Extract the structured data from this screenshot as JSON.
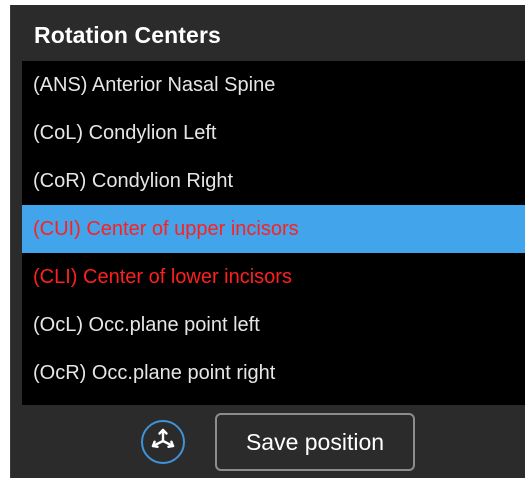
{
  "panel": {
    "title": "Rotation Centers"
  },
  "rotation_centers": {
    "items": [
      {
        "label": "(ANS) Anterior Nasal Spine",
        "selected": false,
        "color": "#e6e6e6"
      },
      {
        "label": "(CoL) Condylion Left",
        "selected": false,
        "color": "#e6e6e6"
      },
      {
        "label": "(CoR) Condylion Right",
        "selected": false,
        "color": "#e6e6e6"
      },
      {
        "label": "(CUI) Center of upper incisors",
        "selected": true,
        "color": "#ff1f1f"
      },
      {
        "label": "(CLI) Center of lower incisors",
        "selected": false,
        "color": "#ff1f1f"
      },
      {
        "label": "(OcL) Occ.plane point left",
        "selected": false,
        "color": "#e6e6e6"
      },
      {
        "label": "(OcR) Occ.plane point right",
        "selected": false,
        "color": "#e6e6e6"
      }
    ],
    "selected_background": "#42a4ea"
  },
  "toolbar": {
    "move_icon": "move-axes-icon",
    "save_label": "Save position"
  },
  "colors": {
    "panel_background": "#2b2b2b",
    "list_background": "#000000",
    "accent": "#3f93d9",
    "highlight_text": "#ff1f1f"
  }
}
